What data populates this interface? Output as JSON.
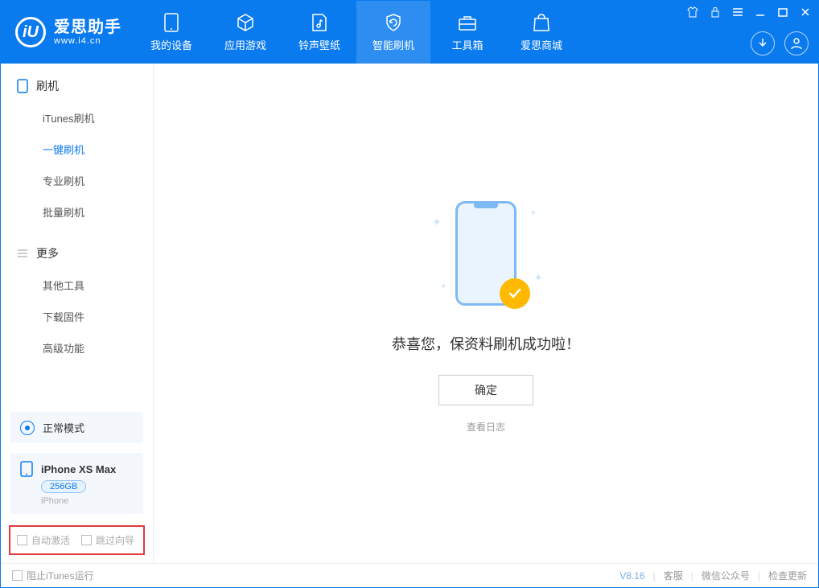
{
  "app": {
    "name": "爱思助手",
    "url": "www.i4.cn",
    "logo_letter": "iU"
  },
  "nav": {
    "tabs": [
      {
        "label": "我的设备"
      },
      {
        "label": "应用游戏"
      },
      {
        "label": "铃声壁纸"
      },
      {
        "label": "智能刷机"
      },
      {
        "label": "工具箱"
      },
      {
        "label": "爱思商城"
      }
    ],
    "active_index": 3
  },
  "sidebar": {
    "groups": [
      {
        "title": "刷机",
        "items": [
          "iTunes刷机",
          "一键刷机",
          "专业刷机",
          "批量刷机"
        ],
        "active": 1
      },
      {
        "title": "更多",
        "items": [
          "其他工具",
          "下载固件",
          "高级功能"
        ],
        "active": -1
      }
    ],
    "mode_label": "正常模式",
    "device": {
      "name": "iPhone XS Max",
      "storage": "256GB",
      "type": "iPhone"
    },
    "checkboxes": {
      "auto_activate": "自动激活",
      "skip_guide": "跳过向导"
    }
  },
  "main": {
    "success_message": "恭喜您，保资料刷机成功啦！",
    "ok_button": "确定",
    "view_log": "查看日志"
  },
  "footer": {
    "block_itunes": "阻止iTunes运行",
    "version": "V8.16",
    "links": [
      "客服",
      "微信公众号",
      "检查更新"
    ]
  }
}
